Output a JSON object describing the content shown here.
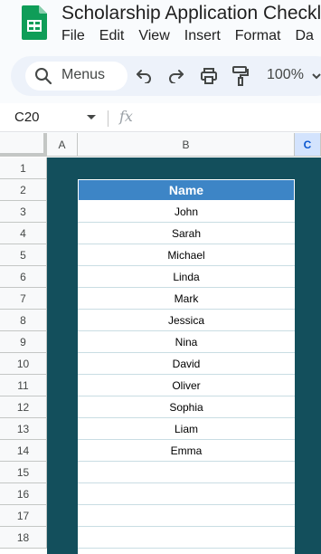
{
  "document": {
    "title": "Scholarship Application Checklis"
  },
  "menubar": {
    "items": [
      "File",
      "Edit",
      "View",
      "Insert",
      "Format",
      "Da"
    ]
  },
  "toolbar": {
    "search_label": "Menus",
    "zoom": "100%",
    "icons": [
      "search-icon",
      "undo-icon",
      "redo-icon",
      "print-icon",
      "paint-format-icon",
      "chevron-down-icon"
    ]
  },
  "formula_bar": {
    "cell_ref": "C20",
    "fx_label": "fx",
    "value": ""
  },
  "grid": {
    "columns": [
      "A",
      "B",
      "C"
    ],
    "selected_column": "C",
    "rows": [
      "1",
      "2",
      "3",
      "4",
      "5",
      "6",
      "7",
      "8",
      "9",
      "10",
      "11",
      "12",
      "13",
      "14",
      "15",
      "16",
      "17",
      "18"
    ]
  },
  "table": {
    "header": "Name",
    "names": [
      "John",
      "Sarah",
      "Michael",
      "Linda",
      "Mark",
      "Jessica",
      "Nina",
      "David",
      "Oliver",
      "Sophia",
      "Liam",
      "Emma",
      "",
      "",
      "",
      ""
    ]
  },
  "colors": {
    "background_fill": "#134f5c",
    "header_fill": "#3d85c6",
    "selected_column": "#d3e3fd",
    "sheets_green": "#0f9d58"
  }
}
